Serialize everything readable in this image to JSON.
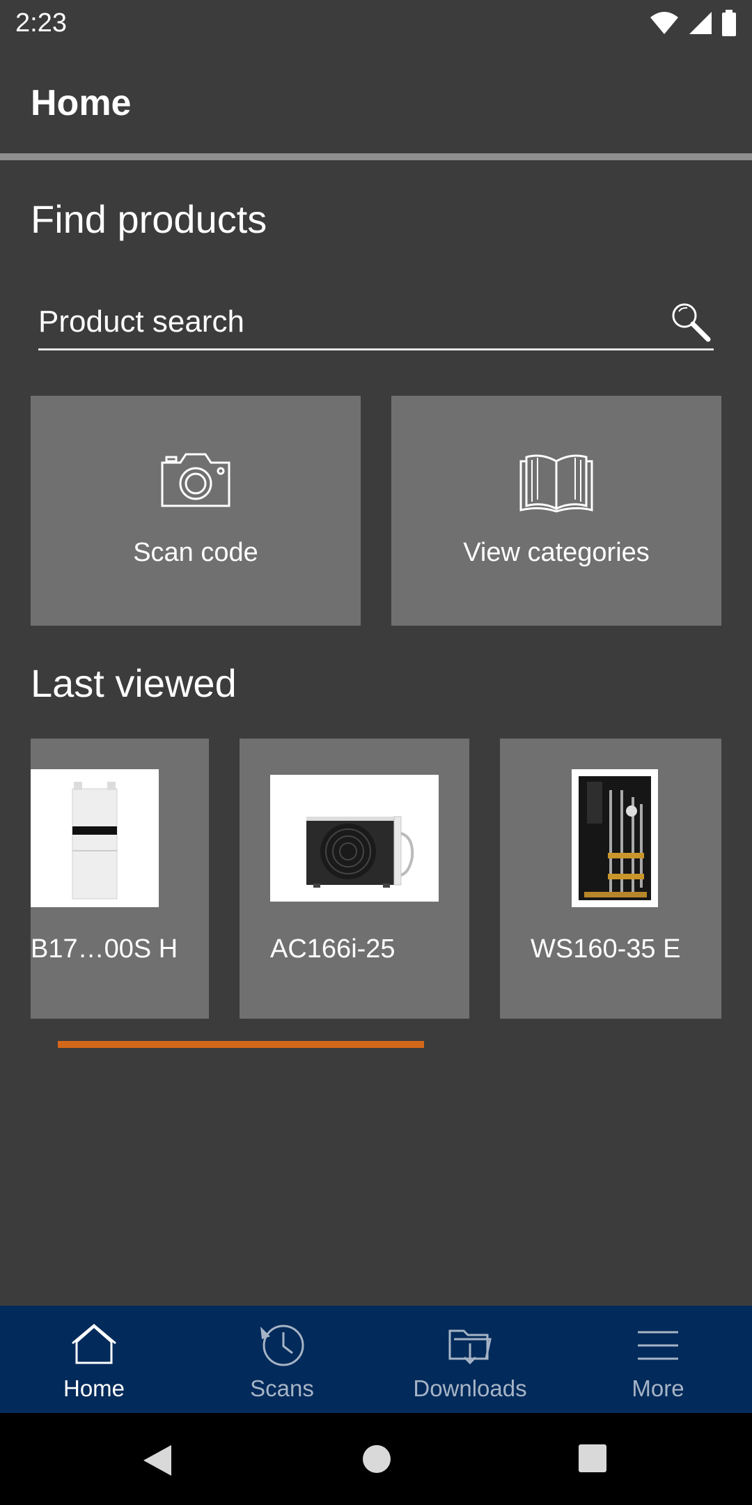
{
  "status_bar": {
    "time": "2:23",
    "icons": [
      "wifi-icon",
      "cell-signal-icon",
      "battery-icon"
    ]
  },
  "header": {
    "title": "Home"
  },
  "find_products": {
    "title": "Find products",
    "search_placeholder": "Product search",
    "tiles": [
      {
        "label": "Scan code",
        "icon": "camera-icon"
      },
      {
        "label": "View categories",
        "icon": "book-icon"
      }
    ]
  },
  "last_viewed": {
    "title": "Last viewed",
    "items": [
      {
        "name": "B17…00S H"
      },
      {
        "name": "AC166i-25"
      },
      {
        "name": "WS160-35 E"
      }
    ]
  },
  "bottom_nav": {
    "items": [
      {
        "label": "Home",
        "icon": "home-icon",
        "active": true
      },
      {
        "label": "Scans",
        "icon": "history-icon",
        "active": false
      },
      {
        "label": "Downloads",
        "icon": "download-folder-icon",
        "active": false
      },
      {
        "label": "More",
        "icon": "menu-icon",
        "active": false
      }
    ]
  },
  "colors": {
    "background": "#3c3c3c",
    "tile": "#707070",
    "accent": "#d4681a",
    "nav_background": "#022a5a"
  }
}
